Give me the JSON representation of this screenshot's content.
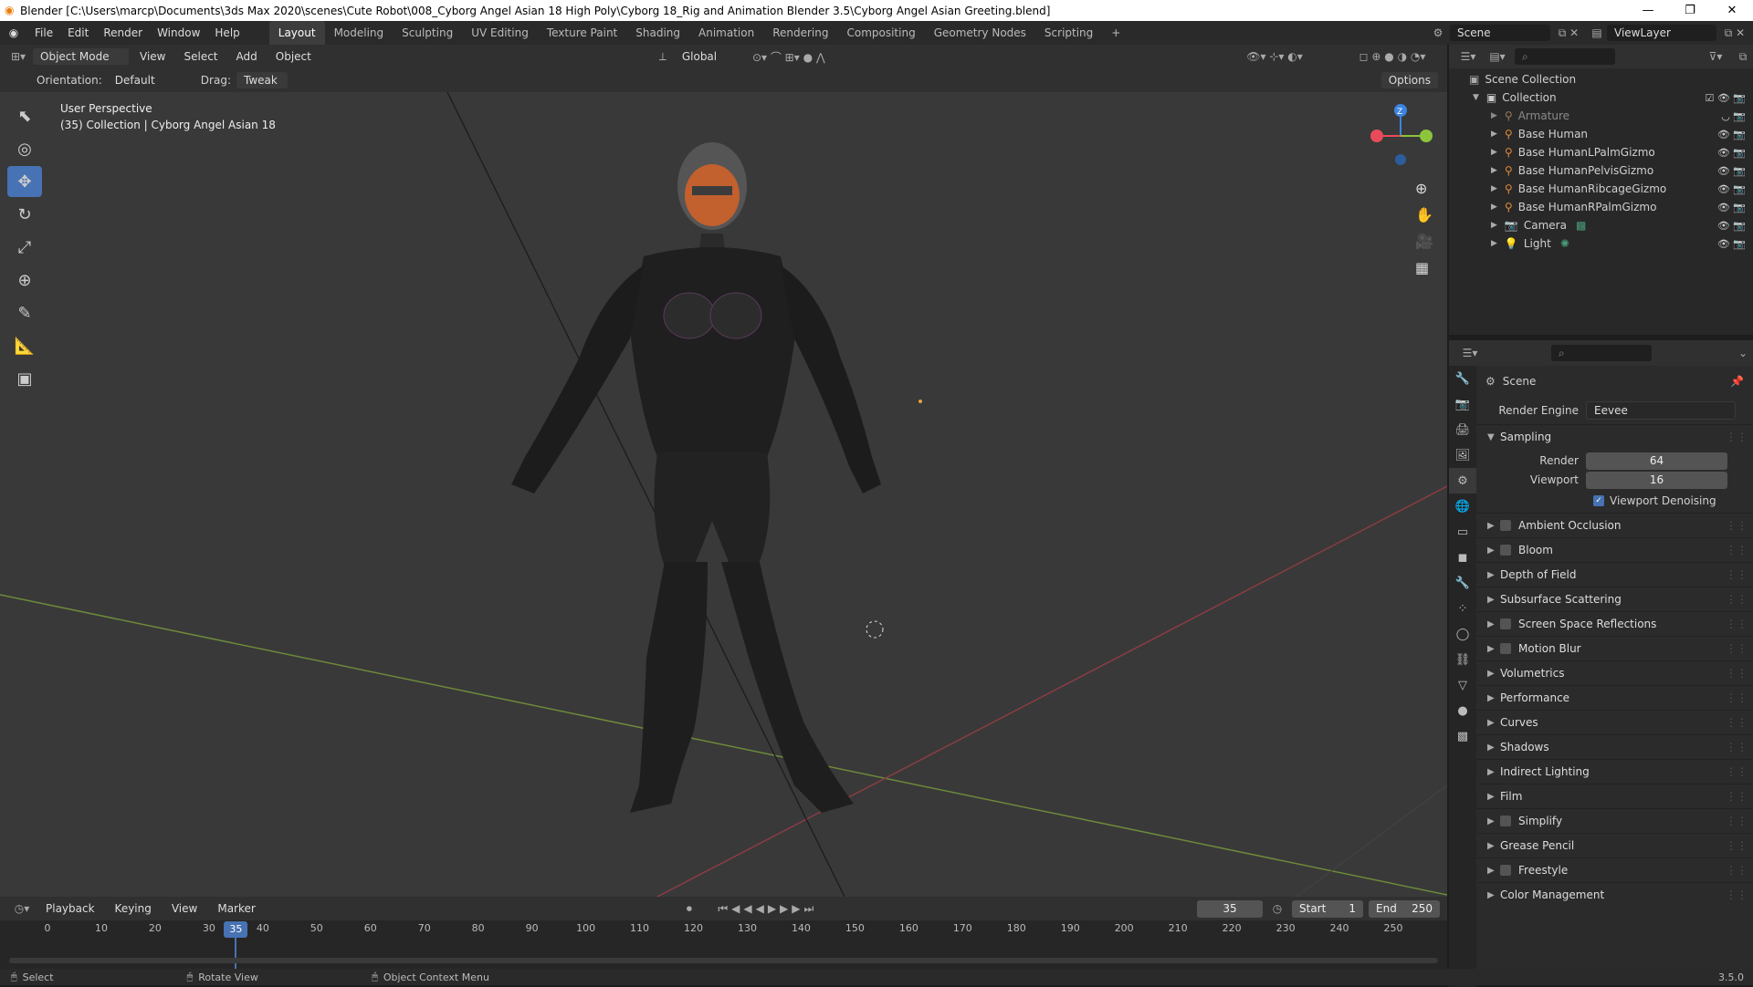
{
  "window": {
    "title": "Blender [C:\\Users\\marcp\\Documents\\3ds Max 2020\\scenes\\Cute Robot\\008_Cyborg Angel Asian 18 High Poly\\Cyborg 18_Rig and Animation Blender 3.5\\Cyborg Angel Asian Greeting.blend]",
    "minimize": "—",
    "maximize": "❐",
    "close": "✕"
  },
  "menu": [
    "File",
    "Edit",
    "Render",
    "Window",
    "Help"
  ],
  "workspaces": [
    "Layout",
    "Modeling",
    "Sculpting",
    "UV Editing",
    "Texture Paint",
    "Shading",
    "Animation",
    "Rendering",
    "Compositing",
    "Geometry Nodes",
    "Scripting"
  ],
  "active_workspace": "Layout",
  "add_workspace": "+",
  "scene_selector": "Scene",
  "view_layer": "ViewLayer",
  "viewport_header": {
    "mode": "Object Mode",
    "menus": [
      "View",
      "Select",
      "Add",
      "Object"
    ],
    "transform_orientation": "Global",
    "options": "Options"
  },
  "tool_settings": {
    "orientation_label": "Orientation:",
    "orientation_value": "Default",
    "drag_label": "Drag:",
    "drag_value": "Tweak"
  },
  "viewport_info": {
    "line1": "User Perspective",
    "line2": "(35) Collection | Cyborg Angel Asian 18"
  },
  "gizmo_axes": {
    "x_color": "#e84b5a",
    "y_color": "#8cc43c",
    "z_color": "#3b85e0",
    "z_label": "Z"
  },
  "outliner": {
    "root": "Scene Collection",
    "collection": "Collection",
    "items": [
      {
        "name": "Armature",
        "dim": true
      },
      {
        "name": "Base Human",
        "dim": false
      },
      {
        "name": "Base HumanLPalmGizmo",
        "dim": false
      },
      {
        "name": "Base HumanPelvisGizmo",
        "dim": false
      },
      {
        "name": "Base HumanRibcageGizmo",
        "dim": false
      },
      {
        "name": "Base HumanRPalmGizmo",
        "dim": false
      },
      {
        "name": "Camera",
        "dim": false
      },
      {
        "name": "Light",
        "dim": false
      }
    ]
  },
  "properties": {
    "context": "Scene",
    "render_engine_label": "Render Engine",
    "render_engine_value": "Eevee",
    "sampling": {
      "title": "Sampling",
      "render_label": "Render",
      "render_value": "64",
      "viewport_label": "Viewport",
      "viewport_value": "16",
      "denoise_label": "Viewport Denoising"
    },
    "sections": [
      {
        "name": "Ambient Occlusion",
        "checkbox": true
      },
      {
        "name": "Bloom",
        "checkbox": true
      },
      {
        "name": "Depth of Field",
        "checkbox": false
      },
      {
        "name": "Subsurface Scattering",
        "checkbox": false
      },
      {
        "name": "Screen Space Reflections",
        "checkbox": true
      },
      {
        "name": "Motion Blur",
        "checkbox": true
      },
      {
        "name": "Volumetrics",
        "checkbox": false
      },
      {
        "name": "Performance",
        "checkbox": false
      },
      {
        "name": "Curves",
        "checkbox": false
      },
      {
        "name": "Shadows",
        "checkbox": false
      },
      {
        "name": "Indirect Lighting",
        "checkbox": false
      },
      {
        "name": "Film",
        "checkbox": false
      },
      {
        "name": "Simplify",
        "checkbox": true
      },
      {
        "name": "Grease Pencil",
        "checkbox": false
      },
      {
        "name": "Freestyle",
        "checkbox": true
      },
      {
        "name": "Color Management",
        "checkbox": false
      }
    ]
  },
  "timeline": {
    "menus": [
      "Playback",
      "Keying",
      "View",
      "Marker"
    ],
    "current_frame": "35",
    "start_label": "Start",
    "start_value": "1",
    "end_label": "End",
    "end_value": "250",
    "ticks": [
      "0",
      "10",
      "20",
      "30",
      "40",
      "50",
      "60",
      "70",
      "80",
      "90",
      "100",
      "110",
      "120",
      "130",
      "140",
      "150",
      "160",
      "170",
      "180",
      "190",
      "200",
      "210",
      "220",
      "230",
      "240",
      "250"
    ]
  },
  "statusbar": {
    "select": "Select",
    "rotate": "Rotate View",
    "context_menu": "Object Context Menu",
    "version": "3.5.0"
  }
}
